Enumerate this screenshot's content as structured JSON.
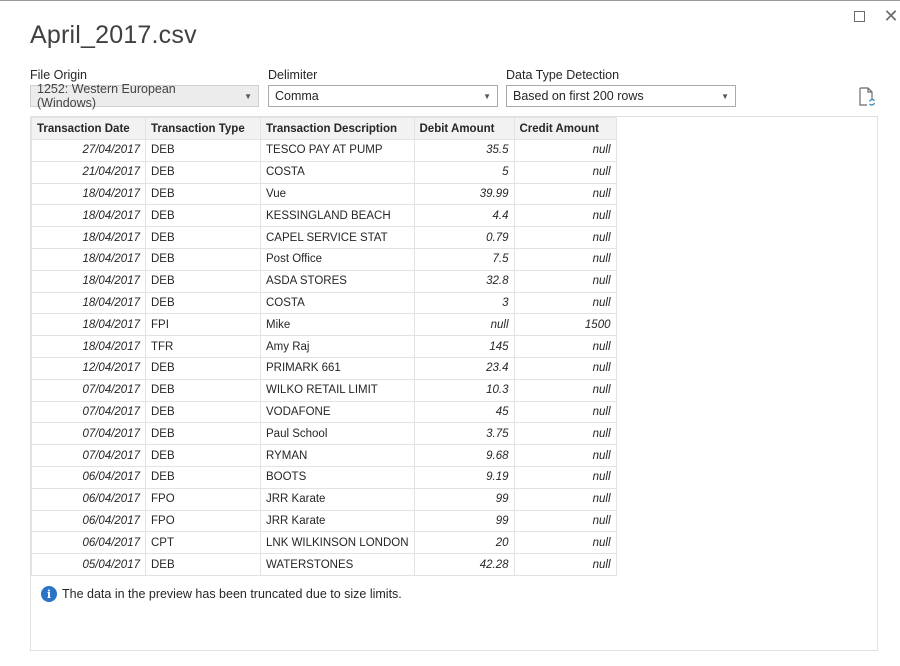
{
  "window": {
    "title": "April_2017.csv",
    "maximize_icon": "maximize-icon",
    "close_icon": "close-icon"
  },
  "options": {
    "file_origin": {
      "label": "File Origin",
      "value": "1252: Western European (Windows)"
    },
    "delimiter": {
      "label": "Delimiter",
      "value": "Comma"
    },
    "data_type_detection": {
      "label": "Data Type Detection",
      "value": "Based on first 200 rows"
    },
    "refresh_icon": "refresh-file-icon"
  },
  "table": {
    "columns": [
      "Transaction Date",
      "Transaction Type",
      "Transaction Description",
      "Debit Amount",
      "Credit Amount"
    ],
    "rows": [
      [
        "27/04/2017",
        "DEB",
        "TESCO PAY AT PUMP",
        "35.5",
        "null"
      ],
      [
        "21/04/2017",
        "DEB",
        "COSTA",
        "5",
        "null"
      ],
      [
        "18/04/2017",
        "DEB",
        "Vue",
        "39.99",
        "null"
      ],
      [
        "18/04/2017",
        "DEB",
        "KESSINGLAND BEACH",
        "4.4",
        "null"
      ],
      [
        "18/04/2017",
        "DEB",
        "CAPEL SERVICE STAT",
        "0.79",
        "null"
      ],
      [
        "18/04/2017",
        "DEB",
        "Post Office",
        "7.5",
        "null"
      ],
      [
        "18/04/2017",
        "DEB",
        "ASDA STORES",
        "32.8",
        "null"
      ],
      [
        "18/04/2017",
        "DEB",
        "COSTA",
        "3",
        "null"
      ],
      [
        "18/04/2017",
        "FPI",
        "Mike",
        "null",
        "1500"
      ],
      [
        "18/04/2017",
        "TFR",
        "Amy Raj",
        "145",
        "null"
      ],
      [
        "12/04/2017",
        "DEB",
        "PRIMARK 661",
        "23.4",
        "null"
      ],
      [
        "07/04/2017",
        "DEB",
        "WILKO RETAIL LIMIT",
        "10.3",
        "null"
      ],
      [
        "07/04/2017",
        "DEB",
        "VODAFONE",
        "45",
        "null"
      ],
      [
        "07/04/2017",
        "DEB",
        "Paul School",
        "3.75",
        "null"
      ],
      [
        "07/04/2017",
        "DEB",
        "RYMAN",
        "9.68",
        "null"
      ],
      [
        "06/04/2017",
        "DEB",
        "BOOTS",
        "9.19",
        "null"
      ],
      [
        "06/04/2017",
        "FPO",
        "JRR Karate",
        "99",
        "null"
      ],
      [
        "06/04/2017",
        "FPO",
        "JRR Karate",
        "99",
        "null"
      ],
      [
        "06/04/2017",
        "CPT",
        "LNK WILKINSON LONDON",
        "20",
        "null"
      ],
      [
        "05/04/2017",
        "DEB",
        "WATERSTONES",
        "42.28",
        "null"
      ]
    ]
  },
  "notice": {
    "icon": "info-icon",
    "text": "The data in the preview has been truncated due to size limits."
  },
  "colors": {
    "info_blue": "#2a73c6",
    "header_bg": "#f2f2f2",
    "disabled_select_bg": "#ececec"
  }
}
